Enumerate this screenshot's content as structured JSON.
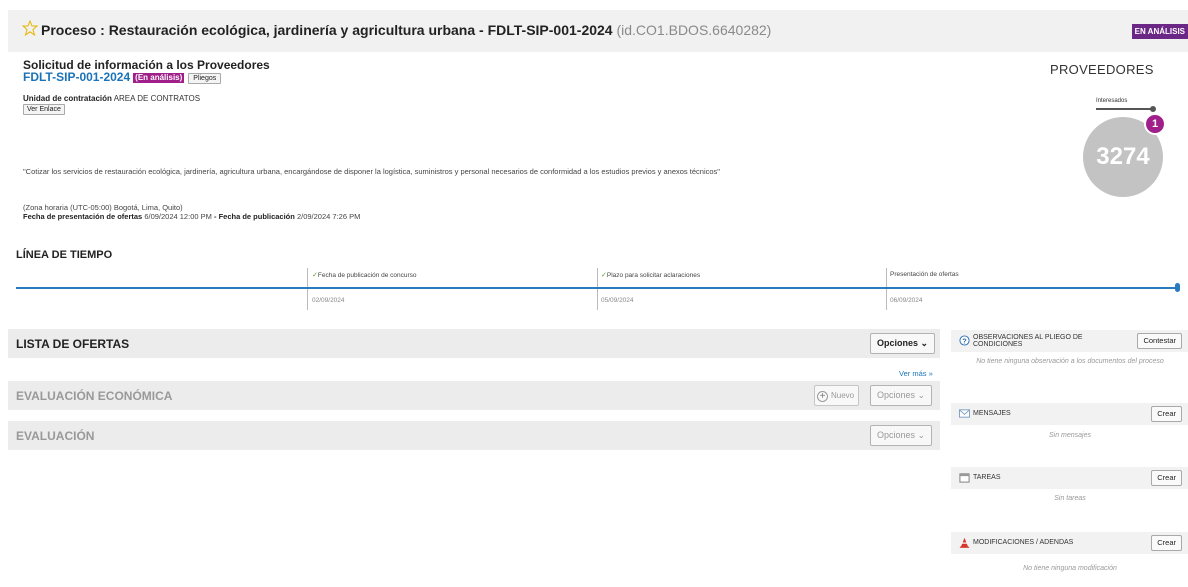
{
  "header": {
    "title": "Proceso : Restauración ecológica, jardinería y agricultura urbana - FDLT-SIP-001-2024",
    "process_id": "(id.CO1.BDOS.6640282)",
    "status": "EN ANÁLISIS"
  },
  "summary": {
    "request_title": "Solicitud de información a los Proveedores",
    "code": "FDLT-SIP-001-2024",
    "code_status": "(En análisis)",
    "pliegos_label": "Pliegos",
    "unit_label": "Unidad de contratación",
    "unit_value": "AREA DE CONTRATOS",
    "ver_enlace_label": "Ver Enlace",
    "description": "\"Cotizar los servicios de restauración ecológica, jardinería, agricultura urbana, encargándose de disponer la logística, suministros y personal necesarios de conformidad a los estudios previos y anexos técnicos\"",
    "timezone": "(Zona horaria (UTC-05:00) Bogotá, Lima, Quito)",
    "offers_date_label": "Fecha de presentación de ofertas",
    "offers_date_value": "6/09/2024 12:00 PM",
    "separator": "-",
    "pub_date_label": "Fecha de publicación",
    "pub_date_value": "2/09/2024 7:26 PM"
  },
  "providers": {
    "title": "PROVEEDORES",
    "interested_label": "Interesados",
    "interested_count": "1",
    "total": "3274"
  },
  "timeline": {
    "title": "LÍNEA DE TIEMPO",
    "events": [
      {
        "label": "Fecha de publicación de concurso",
        "date": "02/09/2024",
        "done": true
      },
      {
        "label": "Plazo para solicitar aclaraciones",
        "date": "05/09/2024",
        "done": true
      },
      {
        "label": "Presentación de ofertas",
        "date": "06/09/2024",
        "done": false
      }
    ]
  },
  "sections": {
    "ofertas": {
      "title": "LISTA DE OFERTAS",
      "options": "Opciones"
    },
    "ver_mas": "Ver más »",
    "economica": {
      "title": "EVALUACIÓN ECONÓMICA",
      "nuevo": "Nuevo",
      "options": "Opciones"
    },
    "evaluacion": {
      "title": "EVALUACIÓN",
      "options": "Opciones"
    }
  },
  "right_panels": {
    "observaciones": {
      "title": "OBSERVACIONES AL PLIEGO DE CONDICIONES",
      "button": "Contestar",
      "note": "No tiene ninguna observación a los documentos del proceso"
    },
    "mensajes": {
      "title": "MENSAJES",
      "button": "Crear",
      "note": "Sin mensajes"
    },
    "tareas": {
      "title": "TAREAS",
      "button": "Crear",
      "note": "Sin tareas"
    },
    "modificaciones": {
      "title": "MODIFICACIONES / ADENDAS",
      "button": "Crear",
      "note": "No tiene ninguna modificación"
    }
  },
  "colors": {
    "status_purple": "#6b2785",
    "badge_magenta": "#a01f8a",
    "link_blue": "#1a73b8",
    "timeline_blue": "#2a7ac0"
  }
}
